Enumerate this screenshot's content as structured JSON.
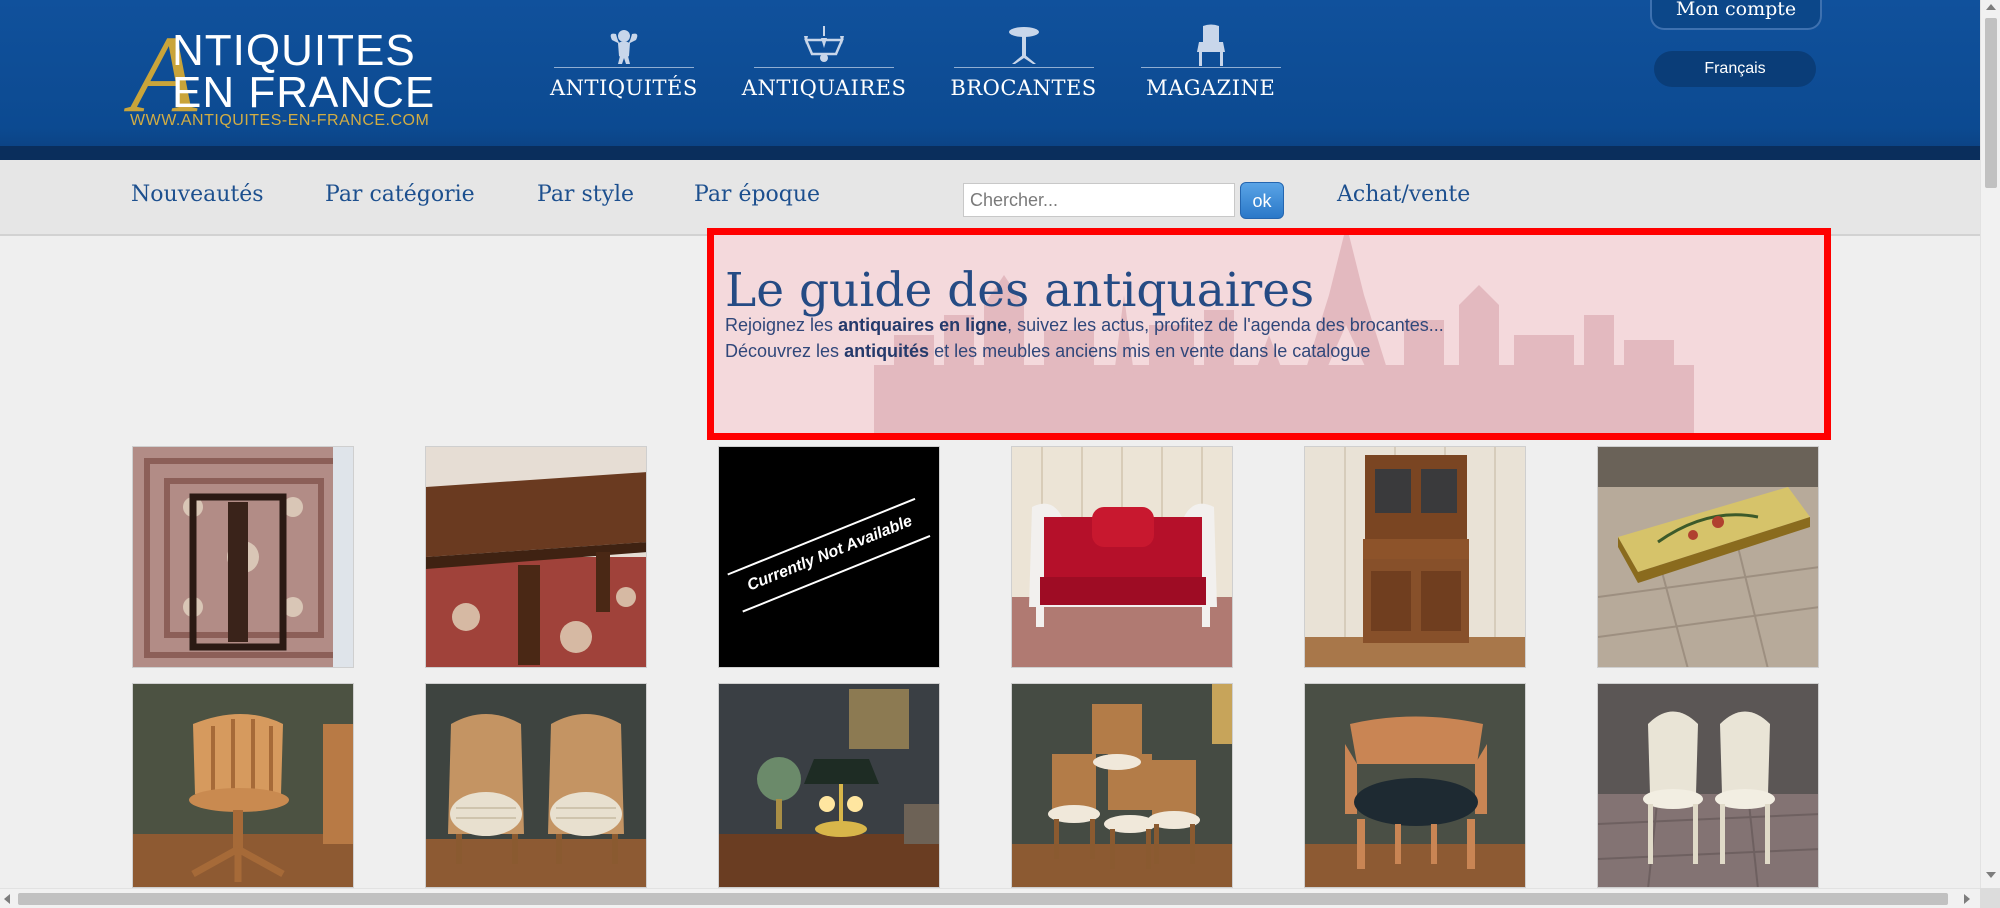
{
  "header": {
    "logo": {
      "line1": "NTIQUITES",
      "line2": "EN FRANCE",
      "big_letter": "A",
      "url": "WWW.ANTIQUITES-EN-FRANCE.COM"
    },
    "main_nav": [
      {
        "label": "ANTIQUITÉS",
        "icon": "cherub-icon"
      },
      {
        "label": "ANTIQUAIRES",
        "icon": "chandelier-icon"
      },
      {
        "label": "BROCANTES",
        "icon": "gueridon-table-icon"
      },
      {
        "label": "MAGAZINE",
        "icon": "armchair-icon"
      }
    ],
    "account_label": "Mon compte",
    "language_label": "Français"
  },
  "subnav": {
    "links": [
      "Nouveautés",
      "Par catégorie",
      "Par style",
      "Par époque"
    ],
    "search_placeholder": "Chercher...",
    "search_button": "ok",
    "trade_link": "Achat/vente"
  },
  "hero": {
    "title": "Le guide des antiquaires",
    "line1": {
      "before": "Rejoignez les ",
      "bold": "antiquaires en ligne",
      "after": ", suivez les actus, profitez de l'agenda des brocantes..."
    },
    "line2": {
      "before": "Découvrez les ",
      "bold": "antiquités",
      "after": " et les meubles anciens mis en vente dans le catalogue"
    }
  },
  "products": {
    "unavailable_text": "Currently Not Available",
    "items": [
      {
        "subject": "table-on-rug"
      },
      {
        "subject": "dining-table"
      },
      {
        "subject": "not-available"
      },
      {
        "subject": "red-velvet-sofa"
      },
      {
        "subject": "walnut-buffet-cabinet"
      },
      {
        "subject": "painted-coffee-table"
      },
      {
        "subject": "office-swivel-chair"
      },
      {
        "subject": "pair-of-cane-bergeres"
      },
      {
        "subject": "bouillotte-lamp-desk"
      },
      {
        "subject": "set-of-cane-chairs"
      },
      {
        "subject": "leather-armchair"
      },
      {
        "subject": "pair-of-white-chairs"
      }
    ]
  },
  "colors": {
    "header_blue": "#0c4a91",
    "gold": "#c9a43a",
    "link_blue": "#1c4f8e",
    "highlight_red": "#ff0000"
  }
}
